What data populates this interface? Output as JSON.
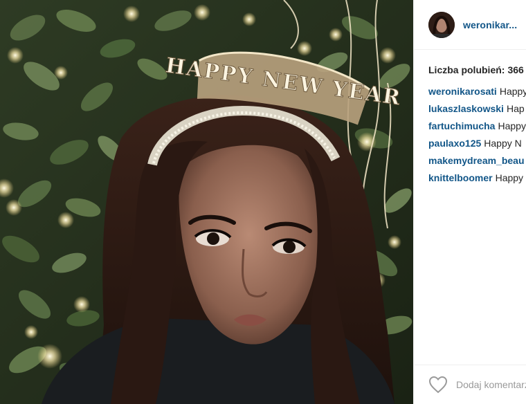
{
  "post": {
    "username": "weronikar...",
    "likes_label": "Liczba polubień:",
    "likes_count": "366",
    "comments": [
      {
        "user": "weronikarosati",
        "text": "Happy"
      },
      {
        "user": "lukaszlaskowski",
        "text": "Hap"
      },
      {
        "user": "fartuchimucha",
        "text": "Happy"
      },
      {
        "user": "paulaxo125",
        "text": "Happy N"
      },
      {
        "user": "makemydream_beau",
        "text": ""
      },
      {
        "user": "knittelboomer",
        "text": "Happy"
      }
    ]
  },
  "photo": {
    "tiara_text": "HAPPY NEW YEAR"
  },
  "footer": {
    "comment_placeholder": "Dodaj komentarz..."
  },
  "colors": {
    "link": "#125688",
    "text": "#262626",
    "divider": "#efefef",
    "placeholder": "#999999"
  }
}
